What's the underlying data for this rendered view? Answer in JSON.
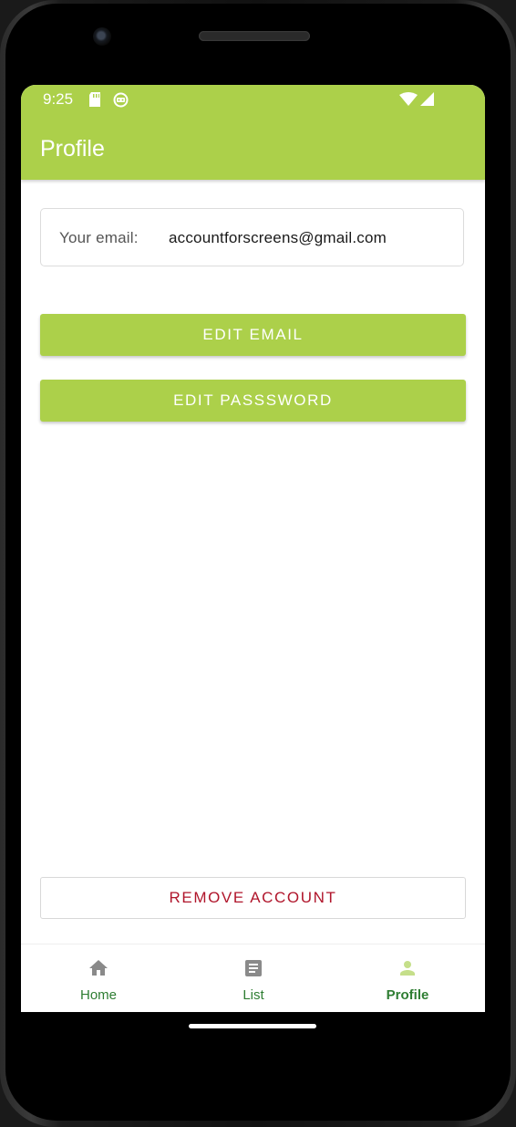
{
  "status_bar": {
    "time": "9:25",
    "icons": [
      "sd-card-icon",
      "app-notification-icon",
      "wifi-icon",
      "signal-icon"
    ]
  },
  "app_bar": {
    "title": "Profile",
    "color": "#acd04a"
  },
  "email_card": {
    "label": "Your email:",
    "value": "accountforscreens@gmail.com"
  },
  "buttons": {
    "edit_email": "EDIT EMAIL",
    "edit_password": "EDIT PASSSWORD",
    "remove_account": "REMOVE ACCOUNT"
  },
  "bottom_nav": {
    "items": [
      {
        "label": "Home",
        "icon": "home-icon",
        "active": false
      },
      {
        "label": "List",
        "icon": "list-icon",
        "active": false
      },
      {
        "label": "Profile",
        "icon": "person-icon",
        "active": true
      }
    ]
  },
  "colors": {
    "accent": "#acd04a",
    "danger": "#b0152b",
    "nav_label": "#2e7d32",
    "nav_icon_inactive": "#8a8a8a",
    "nav_icon_active": "#c5df8a"
  }
}
